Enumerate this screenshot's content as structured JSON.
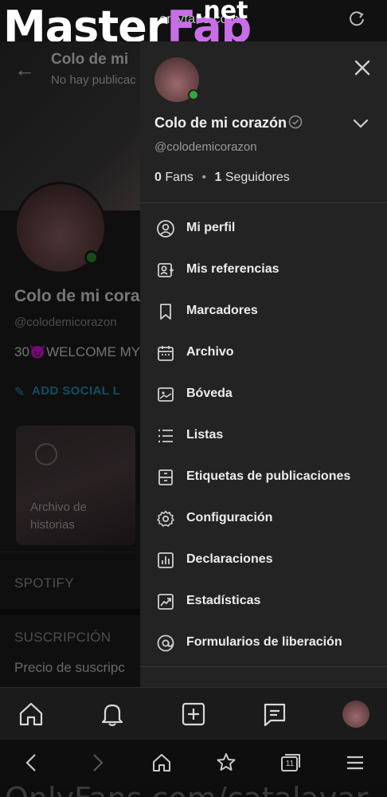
{
  "status_bar": {
    "url": "onlyfans.com",
    "watermark_main": "MasterFap",
    "watermark_suffix": ".net"
  },
  "profile": {
    "cover_title": "Colo de mi",
    "cover_subtitle": "No hay publicac",
    "name": "Colo de mi cora",
    "handle": "@colodemicorazon",
    "bio": "30😈WELCOME MY",
    "add_social_label": "ADD SOCIAL L",
    "story_archive_label": "Archivo de historias",
    "section_spotify": "SPOTIFY",
    "section_subscription": "SUSCRIPCIÓN",
    "price_label": "Precio de suscripc"
  },
  "drawer": {
    "name": "Colo de mi corazón",
    "handle": "@colodemicorazon",
    "fans_count": "0",
    "fans_label": "Fans",
    "followers_count": "1",
    "followers_label": "Seguidores",
    "menu": [
      {
        "label": "Mi perfil",
        "icon": "user-icon"
      },
      {
        "label": "Mis referencias",
        "icon": "referrals-icon"
      },
      {
        "label": "Marcadores",
        "icon": "bookmark-icon"
      },
      {
        "label": "Archivo",
        "icon": "calendar-icon"
      },
      {
        "label": "Bóveda",
        "icon": "vault-icon"
      },
      {
        "label": "Listas",
        "icon": "list-icon"
      },
      {
        "label": "Etiquetas de publicaciones",
        "icon": "tag-icon"
      },
      {
        "label": "Configuración",
        "icon": "gear-icon"
      },
      {
        "label": "Declaraciones",
        "icon": "statements-icon"
      },
      {
        "label": "Estadísticas",
        "icon": "stats-icon"
      },
      {
        "label": "Formularios de liberación",
        "icon": "at-icon"
      }
    ]
  },
  "bottom_nav": [
    "home-icon",
    "bell-icon",
    "add-icon",
    "messages-icon",
    "avatar"
  ],
  "browser": {
    "tabs_count": "11",
    "footer_watermark": "OnlyFans.com/catalavar"
  },
  "colors": {
    "drawer_bg": "#232323",
    "accent": "#1f8fb0",
    "online": "#3aa23a"
  }
}
